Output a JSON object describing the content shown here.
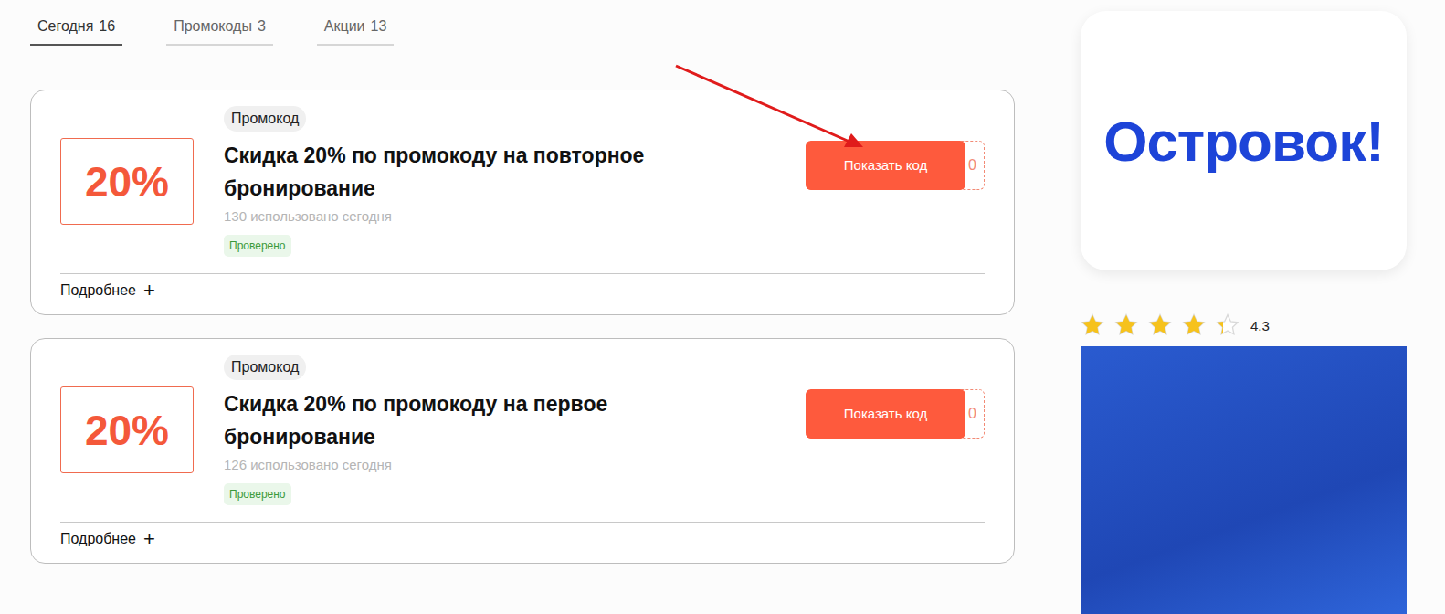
{
  "tabs": [
    {
      "label": "Сегодня",
      "count": "16",
      "selected": true
    },
    {
      "label": "Промокоды",
      "count": "3",
      "selected": false
    },
    {
      "label": "Акции",
      "count": "13",
      "selected": false
    }
  ],
  "offers": [
    {
      "badge": "Промокод",
      "discount": "20%",
      "title": "Скидка 20% по промокоду на повторное бронирование",
      "usage": "130 использовано сегодня",
      "verified": "Проверено",
      "button": "Показать код",
      "code_peek": "0",
      "details": "Подробнее",
      "details_icon": "+"
    },
    {
      "badge": "Промокод",
      "discount": "20%",
      "title": "Скидка 20% по промокоду на первое бронирование",
      "usage": "126 использовано сегодня",
      "verified": "Проверено",
      "button": "Показать код",
      "code_peek": "0",
      "details": "Подробнее",
      "details_icon": "+"
    }
  ],
  "sidebar": {
    "logo": "Островок!",
    "rating": {
      "stars": 4.3,
      "value": "4.3"
    }
  }
}
